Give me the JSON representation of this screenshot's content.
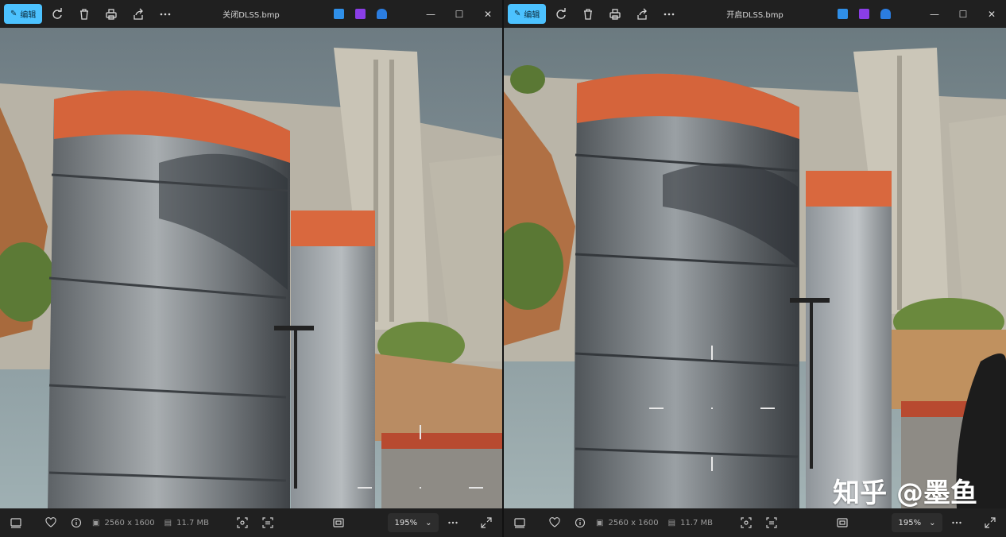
{
  "panes": [
    {
      "title": "关闭DLSS.bmp",
      "edit_label": "编辑",
      "dimensions": "2560 x 1600",
      "file_size": "11.7 MB",
      "zoom": "195%",
      "watermark": ""
    },
    {
      "title": "开启DLSS.bmp",
      "edit_label": "编辑",
      "dimensions": "2560 x 1600",
      "file_size": "11.7 MB",
      "zoom": "195%",
      "watermark": "知乎 @墨鱼"
    }
  ],
  "icons": {
    "rotate": "rotate-icon",
    "delete": "delete-icon",
    "print": "print-icon",
    "share": "share-icon",
    "more": "more-icon",
    "favorite": "heart-icon",
    "info": "info-icon",
    "filmstrip": "filmstrip-icon",
    "fit": "fit-window-icon",
    "fullscreen": "fullscreen-icon"
  },
  "colors": {
    "accent": "#4cc2ff",
    "toolbar_bg": "#202020"
  }
}
